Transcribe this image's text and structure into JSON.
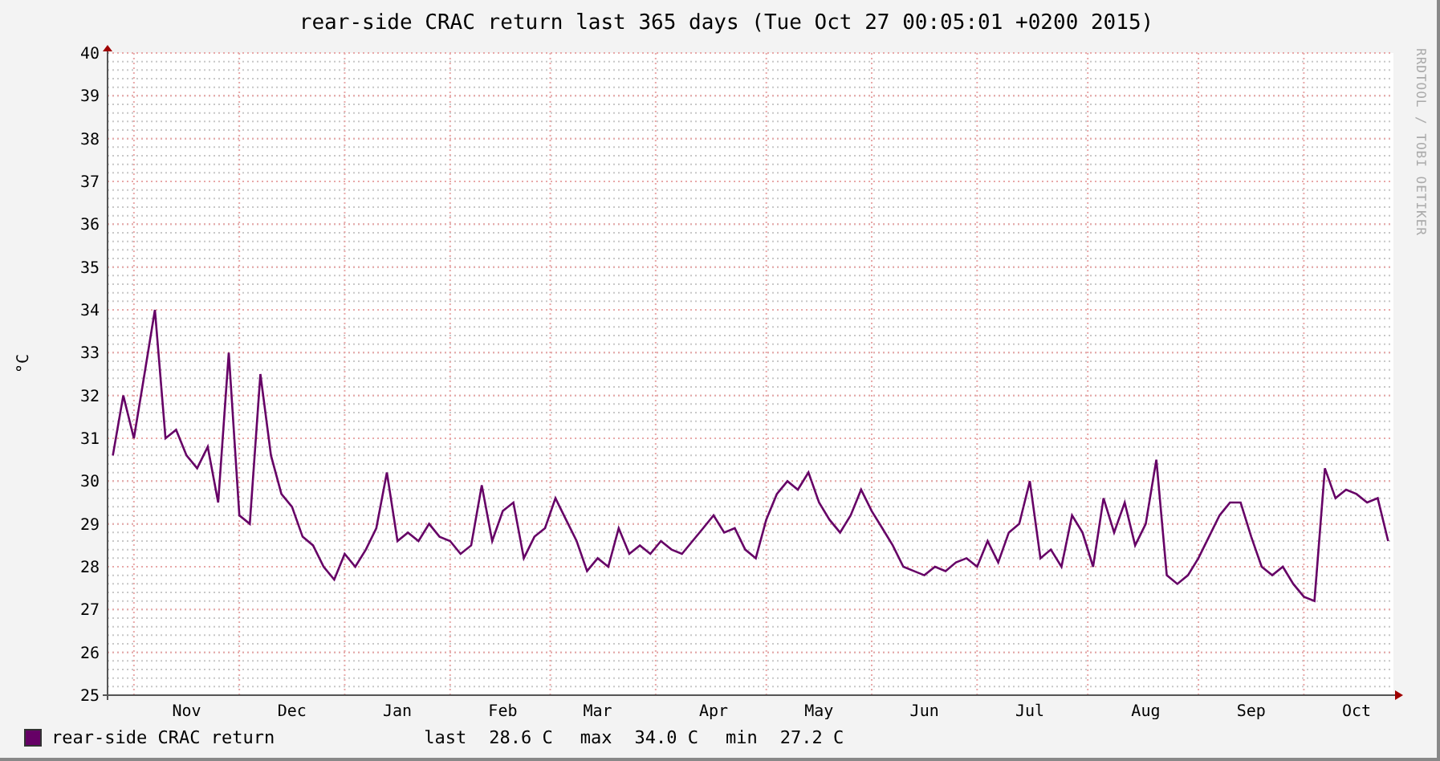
{
  "chart_data": {
    "type": "line",
    "title": "rear-side CRAC return last 365 days (Tue Oct 27 00:05:01 +0200 2015)",
    "ylabel": "°C",
    "ylim": [
      25,
      40
    ],
    "grid": true,
    "categories": [
      null,
      null,
      null,
      null,
      null,
      null,
      null,
      "Nov",
      null,
      null,
      null,
      null,
      null,
      null,
      null,
      null,
      null,
      "Dec",
      null,
      null,
      null,
      null,
      null,
      null,
      null,
      null,
      null,
      "Jan",
      null,
      null,
      null,
      null,
      null,
      null,
      null,
      null,
      null,
      "Feb",
      null,
      null,
      null,
      null,
      null,
      null,
      null,
      null,
      "Mar",
      null,
      null,
      null,
      null,
      null,
      null,
      null,
      null,
      null,
      null,
      "Apr",
      null,
      null,
      null,
      null,
      null,
      null,
      null,
      null,
      null,
      "May",
      null,
      null,
      null,
      null,
      null,
      null,
      null,
      null,
      null,
      "Jun",
      null,
      null,
      null,
      null,
      null,
      null,
      null,
      null,
      null,
      "Jul",
      null,
      null,
      null,
      null,
      null,
      null,
      null,
      null,
      null,
      null,
      "Aug",
      null,
      null,
      null,
      null,
      null,
      null,
      null,
      null,
      null,
      "Sep",
      null,
      null,
      null,
      null,
      null,
      null,
      null,
      null,
      null,
      "Oct",
      null,
      null,
      null
    ],
    "yticks": [
      25,
      26,
      27,
      28,
      29,
      30,
      31,
      32,
      33,
      34,
      35,
      36,
      37,
      38,
      39,
      40
    ],
    "series": [
      {
        "name": "rear-side CRAC return",
        "color": "#660066",
        "values": [
          30.6,
          32.0,
          31.0,
          32.5,
          34.0,
          31.0,
          31.2,
          30.6,
          30.3,
          30.8,
          29.5,
          33.0,
          29.2,
          29.0,
          32.5,
          30.6,
          29.7,
          29.4,
          28.7,
          28.5,
          28.0,
          27.7,
          28.3,
          28.0,
          28.4,
          28.9,
          30.2,
          28.6,
          28.8,
          28.6,
          29.0,
          28.7,
          28.6,
          28.3,
          28.5,
          29.9,
          28.6,
          29.3,
          29.5,
          28.2,
          28.7,
          28.9,
          29.6,
          29.1,
          28.6,
          27.9,
          28.2,
          28.0,
          28.9,
          28.3,
          28.5,
          28.3,
          28.6,
          28.4,
          28.3,
          28.6,
          28.9,
          29.2,
          28.8,
          28.9,
          28.4,
          28.2,
          29.1,
          29.7,
          30.0,
          29.8,
          30.2,
          29.5,
          29.1,
          28.8,
          29.2,
          29.8,
          29.3,
          28.9,
          28.5,
          28.0,
          27.9,
          27.8,
          28.0,
          27.9,
          28.1,
          28.2,
          28.0,
          28.6,
          28.1,
          28.8,
          29.0,
          30.0,
          28.2,
          28.4,
          28.0,
          29.2,
          28.8,
          28.0,
          29.6,
          28.8,
          29.5,
          28.5,
          29.0,
          30.5,
          27.8,
          27.6,
          27.8,
          28.2,
          28.7,
          29.2,
          29.5,
          29.5,
          28.7,
          28.0,
          27.8,
          28.0,
          27.6,
          27.3,
          27.2,
          30.3,
          29.6,
          29.8,
          29.7,
          29.5,
          29.6,
          28.6
        ]
      }
    ]
  },
  "legend": {
    "stats": [
      {
        "label": "last",
        "value": "28.6 C"
      },
      {
        "label": "max",
        "value": "34.0 C"
      },
      {
        "label": "min",
        "value": "27.2 C"
      }
    ]
  },
  "credit": "RRDTOOL / TOBI OETIKER"
}
